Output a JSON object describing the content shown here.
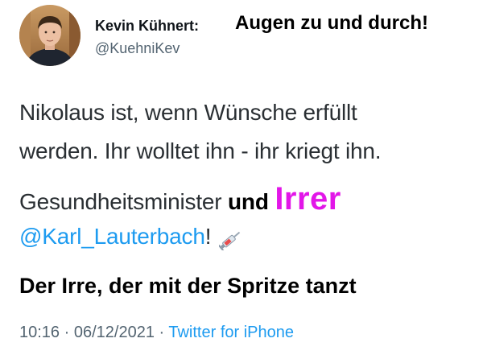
{
  "header": {
    "display_name": "Kevin Kühnert:",
    "handle": "@KuehniKev",
    "caption": "Augen zu und durch!"
  },
  "tweet": {
    "line1": "Nikolaus ist, wenn Wünsche erfüllt",
    "line2": "werden. Ihr wolltet ihn - ihr kriegt ihn.",
    "line3_prefix": "Gesundheitsminister ",
    "line3_bold": "und ",
    "line3_highlight": "Irrer",
    "mention": "@Karl_Lauterbach",
    "mention_suffix": "!",
    "emoji_icon": "syringe-icon"
  },
  "caption_bottom": "Der Irre, der mit der Spritze tanzt",
  "meta": {
    "time": "10:16",
    "separator1": " · ",
    "date": "06/12/2021",
    "separator2": " · ",
    "source": "Twitter for iPhone"
  },
  "colors": {
    "mention": "#1d9bf0",
    "highlight": "#e216e8",
    "meta": "#536471"
  }
}
